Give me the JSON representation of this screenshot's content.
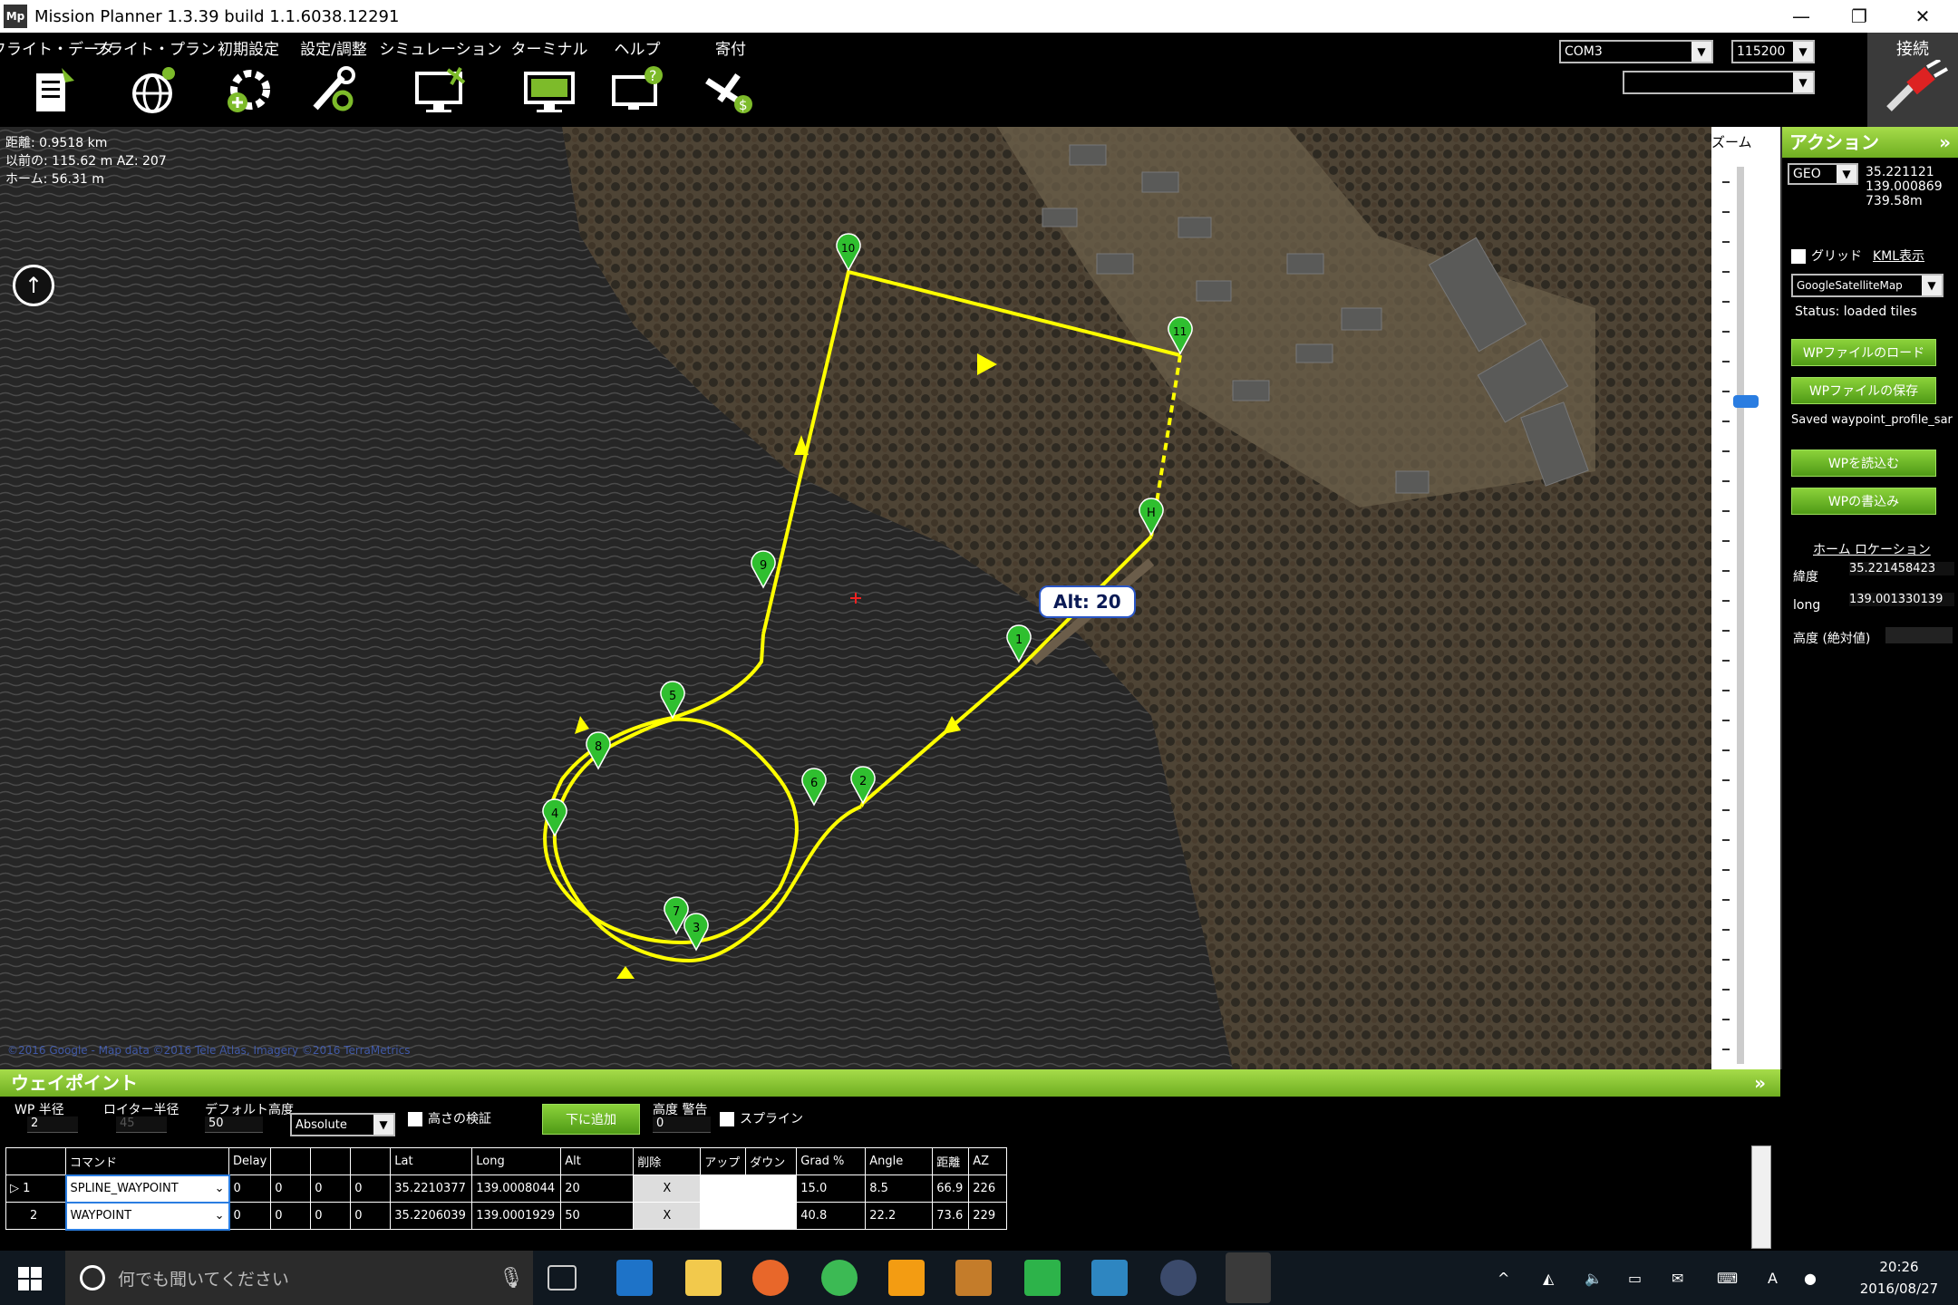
{
  "window": {
    "title": "Mission Planner 1.3.39 build 1.1.6038.12291",
    "icon_text": "Mp"
  },
  "menu": [
    {
      "label": "フライト・データ",
      "icon": "flight-data-icon"
    },
    {
      "label": "フライト・プラン",
      "icon": "flight-plan-icon"
    },
    {
      "label": "初期設定",
      "icon": "initial-setup-icon"
    },
    {
      "label": "設定/調整",
      "icon": "config-tuning-icon"
    },
    {
      "label": "シミュレーション",
      "icon": "simulation-icon"
    },
    {
      "label": "ターミナル",
      "icon": "terminal-icon"
    },
    {
      "label": "ヘルプ",
      "icon": "help-icon"
    },
    {
      "label": "寄付",
      "icon": "donate-icon"
    }
  ],
  "connection": {
    "port": "COM3",
    "baud": "115200",
    "profile": "",
    "connect_label": "接続"
  },
  "map": {
    "info_distance": "距離: 0.9518 km",
    "info_prev": "以前の: 115.62 m AZ: 207",
    "info_home": "ホーム: 56.31 m",
    "alt_label": "Alt: 20",
    "copyright": "©2016 Google - Map data ©2016 Tele Atlas, Imagery ©2016 TerraMetrics",
    "markers": [
      "1",
      "2",
      "3",
      "4",
      "5",
      "6",
      "7",
      "8",
      "9",
      "10",
      "11",
      "H"
    ]
  },
  "zoom": {
    "label": "ズーム"
  },
  "actions": {
    "header": "アクション",
    "coord_mode": "GEO",
    "coord_lat": "35.221121",
    "coord_lng": "139.000869",
    "coord_alt": "739.58m",
    "grid_label": "グリッド",
    "kml_label": "KML表示",
    "map_type": "GoogleSatelliteMap",
    "status": "Status: loaded tiles",
    "load_wp_file": "WPファイルのロード",
    "save_wp_file": "WPファイルの保存",
    "saved_note": "Saved waypoint_profile_sar",
    "read_wp": "WPを読込む",
    "write_wp": "WPの書込み",
    "home_location": "ホーム ロケーション",
    "lat_label": "緯度",
    "lat_value": "35.221458423",
    "long_label": "long",
    "long_value": "139.001330139",
    "alt_label": "高度 (絶対値)"
  },
  "waypoints": {
    "header": "ウェイポイント",
    "wp_radius_label": "WP 半径",
    "wp_radius": "2",
    "loiter_radius_label": "ロイター半径",
    "loiter_radius": "45",
    "default_alt_label": "デフォルト高度",
    "default_alt": "50",
    "alt_mode": "Absolute",
    "verify_height_label": "高さの検証",
    "add_below_label": "下に追加",
    "alt_warn_label": "高度 警告",
    "alt_warn": "0",
    "spline_label": "スプライン",
    "columns": [
      "",
      "コマンド",
      "Delay",
      "",
      "",
      "",
      "Lat",
      "Long",
      "Alt",
      "削除",
      "アップ",
      "ダウン",
      "Grad %",
      "Angle",
      "距離",
      "AZ"
    ],
    "rows": [
      {
        "num": "1",
        "cmd": "SPLINE_WAYPOINT",
        "p1": "0",
        "p2": "0",
        "p3": "0",
        "p4": "0",
        "lat": "35.2210377",
        "lng": "139.0008044",
        "alt": "20",
        "del": "X",
        "grad": "15.0",
        "angle": "8.5",
        "dist": "66.9",
        "az": "226"
      },
      {
        "num": "2",
        "cmd": "WAYPOINT",
        "p1": "0",
        "p2": "0",
        "p3": "0",
        "p4": "0",
        "lat": "35.2206039",
        "lng": "139.0001929",
        "alt": "50",
        "del": "X",
        "grad": "40.8",
        "angle": "22.2",
        "dist": "73.6",
        "az": "229"
      }
    ]
  },
  "taskbar": {
    "search_placeholder": "何でも聞いてください",
    "time": "20:26",
    "date": "2016/08/27",
    "ime": "A"
  },
  "colors": {
    "accent_green": "#7dbb2a",
    "path_yellow": "#ffff00",
    "marker_green": "#2fbf2f"
  }
}
